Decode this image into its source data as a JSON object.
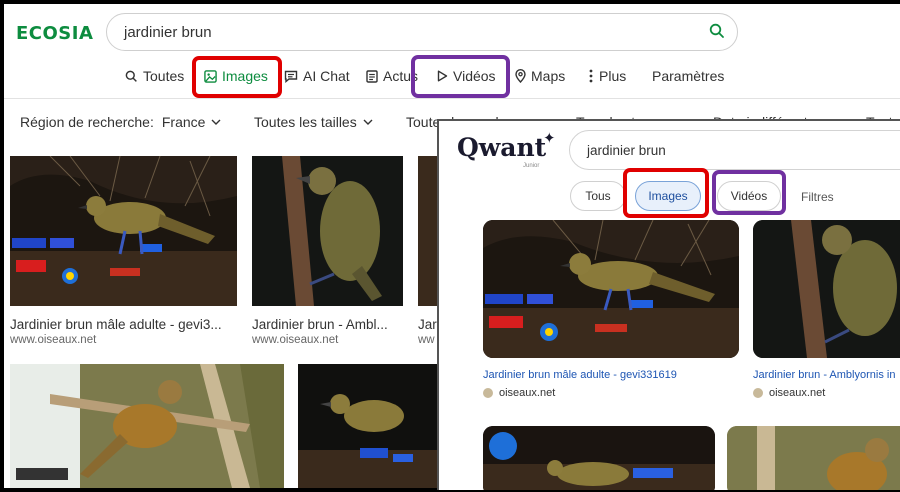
{
  "ecosia": {
    "logo": "ECOSIA",
    "search_value": "jardinier brun",
    "nav": {
      "all": "Toutes",
      "images": "Images",
      "ai_chat": "AI Chat",
      "news": "Actus",
      "videos": "Vidéos",
      "maps": "Maps",
      "more": "Plus",
      "settings": "Paramètres"
    },
    "filters": {
      "region_label": "Région de recherche:",
      "region_value": "France",
      "sizes": "Toutes les tailles",
      "colors": "Toutes les couleurs",
      "types": "Tous les types",
      "date": "Date indifférente",
      "more": "Tout"
    },
    "results": [
      {
        "title": "Jardinier brun mâle adulte - gevi3...",
        "source": "www.oiseaux.net"
      },
      {
        "title": "Jardinier brun - Ambl...",
        "source": "www.oiseaux.net"
      },
      {
        "title": "Jar",
        "source": "ww"
      }
    ],
    "accent": "#0d8c3f"
  },
  "qwant": {
    "logo": "Qwant",
    "logo_star": "✦",
    "logo_sub": "Junior",
    "search_value": "jardinier brun",
    "tabs": {
      "all": "Tous",
      "images": "Images",
      "videos": "Vidéos",
      "filters": "Filtres"
    },
    "results": [
      {
        "title": "Jardinier brun mâle adulte - gevi331619",
        "source": "oiseaux.net"
      },
      {
        "title": "Jardinier brun - Amblyornis in",
        "source": "oiseaux.net"
      }
    ],
    "link_color": "#1d55b3"
  },
  "annotations": {
    "red": "#e00000",
    "purple": "#7030a0"
  }
}
